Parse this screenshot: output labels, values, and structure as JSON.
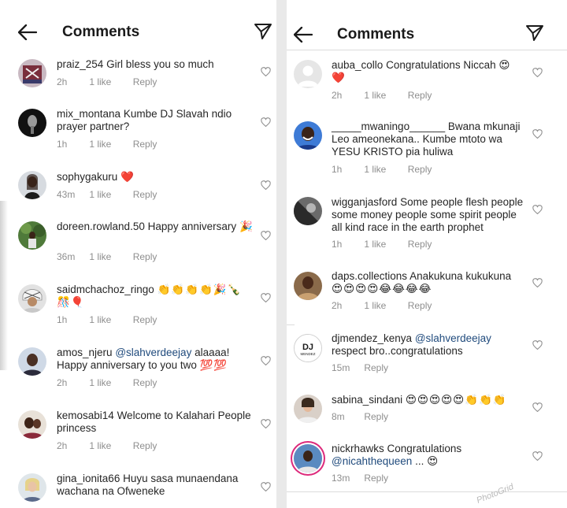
{
  "left_panel": {
    "header": {
      "title": "Comments"
    },
    "comments": [
      {
        "username": "praiz_254",
        "text": "Girl bless you so much",
        "emoji": "",
        "time": "2h",
        "likes": "1 like",
        "reply": "Reply"
      },
      {
        "username": "mix_montana",
        "text": "Kumbe DJ Slavah ndio prayer partner?",
        "emoji": "",
        "time": "1h",
        "likes": "1 like",
        "reply": "Reply"
      },
      {
        "username": "sophygakuru",
        "text": "",
        "emoji": "❤️",
        "time": "43m",
        "likes": "1 like",
        "reply": "Reply"
      },
      {
        "username": "doreen.rowland.50",
        "text": "Happy anniversary",
        "emoji": "🎉",
        "time": "36m",
        "likes": "1 like",
        "reply": "Reply"
      },
      {
        "username": "saidmchachoz_ringo",
        "text": "",
        "emoji": "👏👏👏👏🎉🍾🎊🎈",
        "time": "1h",
        "likes": "1 like",
        "reply": "Reply"
      },
      {
        "username": "amos_njeru",
        "mention": "@slahverdeejay",
        "text": "alaaaa! Happy anniversary to you two",
        "emoji": "💯💯",
        "time": "2h",
        "likes": "1 like",
        "reply": "Reply"
      },
      {
        "username": "kemosabi14",
        "text": "Welcome to Kalahari People princess",
        "emoji": "",
        "time": "2h",
        "likes": "1 like",
        "reply": "Reply"
      },
      {
        "username": "gina_ionita66",
        "text": "Huyu sasa munaendana wachana na Ofweneke",
        "emoji": "",
        "time": "",
        "likes": "",
        "reply": ""
      }
    ]
  },
  "right_panel": {
    "header": {
      "title": "Comments"
    },
    "comments": [
      {
        "username": "auba_collo",
        "text": "Congratulations Niccah",
        "emoji": "😍❤️",
        "time": "2h",
        "likes": "1 like",
        "reply": "Reply"
      },
      {
        "username": "_____mwaningo______",
        "text": "Bwana mkunaji Leo ameonekana.. Kumbe mtoto wa YESU KRISTO pia huliwa",
        "emoji": "",
        "time": "1h",
        "likes": "1 like",
        "reply": "Reply"
      },
      {
        "username": "wigganjasford",
        "text": "Some people flesh people some money people some spirit people all kind race in the earth prophet",
        "emoji": "",
        "time": "1h",
        "likes": "1 like",
        "reply": "Reply"
      },
      {
        "username": "daps.collections",
        "text": "Anakukuna kukukuna",
        "emoji": "😍😍😍😍😂😂😂😂",
        "time": "2h",
        "likes": "1 like",
        "reply": "Reply"
      },
      {
        "username": "djmendez_kenya",
        "mention": "@slahverdeejay",
        "text": "respect bro..congratulations",
        "emoji": "",
        "time": "15m",
        "likes": "",
        "reply": "Reply",
        "avatar_label": "DJ",
        "avatar_sub": "MENDEZ"
      },
      {
        "username": "sabina_sindani",
        "text": "",
        "emoji": "😍😍😍😍😍👏👏👏",
        "time": "8m",
        "likes": "",
        "reply": "Reply"
      },
      {
        "username": "nickrhawks",
        "text": "Congratulations",
        "mention": "@nicahthequeen",
        "text2": "...",
        "emoji": "😍",
        "time": "13m",
        "likes": "",
        "reply": "Reply"
      }
    ]
  },
  "watermark": "PhotoGrid",
  "colors": {
    "accent_link": "#1f4a7c",
    "heart": "#e0182d",
    "meta_gray": "#8e8e8e",
    "story_ring": "#dd2a7b"
  },
  "icons": [
    "back-arrow-icon",
    "send-icon",
    "heart-outline-icon",
    "default-avatar-icon"
  ]
}
